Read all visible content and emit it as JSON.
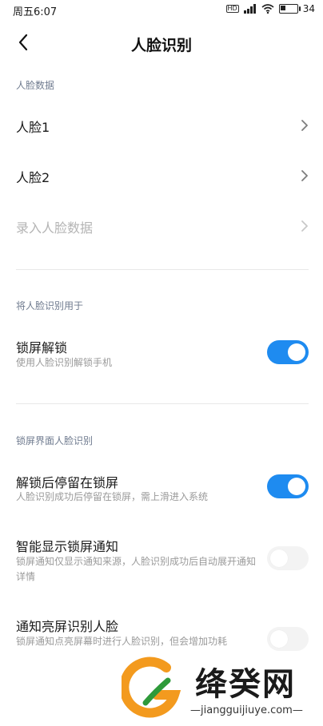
{
  "status_bar": {
    "time": "周五6:07",
    "network_badge": "HD",
    "battery_level": "34",
    "battery_fraction": 0.34
  },
  "header": {
    "title": "人脸识别",
    "back_icon": "chevron-left-icon"
  },
  "sections": {
    "face_data": {
      "title": "人脸数据",
      "items": [
        {
          "label": "人脸1"
        },
        {
          "label": "人脸2"
        },
        {
          "label": "录入人脸数据",
          "disabled": true
        }
      ]
    },
    "use_for": {
      "title": "将人脸识别用于",
      "items": [
        {
          "label": "锁屏解锁",
          "subtitle": "使用人脸识别解锁手机",
          "enabled": true
        }
      ]
    },
    "lockscreen": {
      "title": "锁屏界面人脸识别",
      "items": [
        {
          "label": "解锁后停留在锁屏",
          "subtitle": "人脸识别成功后停留在锁屏，需上滑进入系统",
          "enabled": true
        },
        {
          "label": "智能显示锁屏通知",
          "subtitle": "锁屏通知仅显示通知来源，人脸识别成功后自动展开通知详情",
          "enabled": false
        },
        {
          "label": "通知亮屏识别人脸",
          "subtitle": "锁屏通知点亮屏幕时进行人脸识别，但会增加功耗",
          "enabled": false
        }
      ]
    }
  },
  "watermark": {
    "name": "绛癸网",
    "url": "—jiangguijiuye.com—"
  },
  "colors": {
    "accent": "#1e8bf0",
    "section_title": "#6f7b8f",
    "watermark_orange": "#f39a1e",
    "watermark_green": "#2e9a3a"
  }
}
